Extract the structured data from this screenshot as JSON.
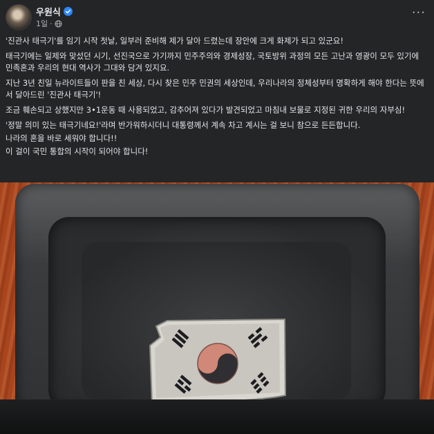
{
  "post": {
    "author": "우원식",
    "time": "1일",
    "more_label": "···"
  },
  "paragraphs": [
    "'진관사 태극기'를 임기 시작 첫날, 일부러 준비해 제가 달아 드렸는데 장안에 크게 화제가 되고 있군요!",
    "태극기에는 일제와 맞섰던 시기, 선진국으로 가기까지 민주주의와 경제성장, 국토방위 과정의 모든 고난과 영광이 모두 있기에 민족혼과 우리의 현대 역사가 그대와 담겨 있지요.",
    "지난 3년 친일 뉴라이트들이 판을 친 세상, 다시 찾은 민주 민권의 세상인데, 우리나라의 정체성부터 명확하게 해야 한다는 뜻에서 달아드린 '진관사 태극기'!",
    "조금 훼손되고 상했지만 3•1운동 때 사용되었고, 감추어져 있다가 발견되었고 마침내 보물로 지정된 귀한 우리의 자부심!",
    "'정말 의미 있는 태극기네요!'라며 반가워하시더니 대통령께서 계속 차고 계시는 걸 보니 참으로 든든합니다.",
    "나라의 혼을 바로 세워야 합니다!!",
    "이 걸이 국민 통합의 시작이 되어야 합니다!"
  ],
  "colors": {
    "background": "#242526",
    "text": "#e4e6eb",
    "secondary_text": "#b0b3b8",
    "verified": "#2d88ff"
  }
}
